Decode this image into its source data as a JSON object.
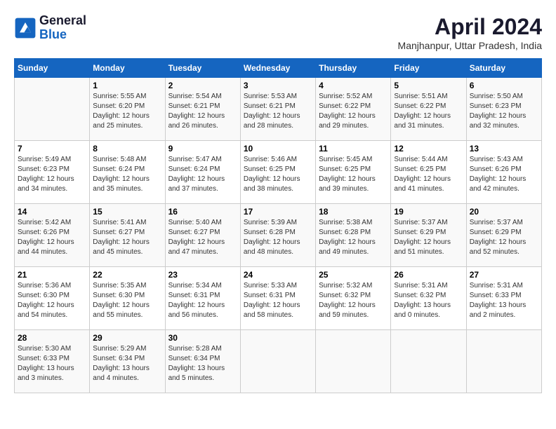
{
  "logo": {
    "line1": "General",
    "line2": "Blue"
  },
  "title": "April 2024",
  "location": "Manjhanpur, Uttar Pradesh, India",
  "weekdays": [
    "Sunday",
    "Monday",
    "Tuesday",
    "Wednesday",
    "Thursday",
    "Friday",
    "Saturday"
  ],
  "days": [
    {
      "num": "",
      "sunrise": "",
      "sunset": "",
      "daylight": ""
    },
    {
      "num": "1",
      "sunrise": "Sunrise: 5:55 AM",
      "sunset": "Sunset: 6:20 PM",
      "daylight": "Daylight: 12 hours and 25 minutes."
    },
    {
      "num": "2",
      "sunrise": "Sunrise: 5:54 AM",
      "sunset": "Sunset: 6:21 PM",
      "daylight": "Daylight: 12 hours and 26 minutes."
    },
    {
      "num": "3",
      "sunrise": "Sunrise: 5:53 AM",
      "sunset": "Sunset: 6:21 PM",
      "daylight": "Daylight: 12 hours and 28 minutes."
    },
    {
      "num": "4",
      "sunrise": "Sunrise: 5:52 AM",
      "sunset": "Sunset: 6:22 PM",
      "daylight": "Daylight: 12 hours and 29 minutes."
    },
    {
      "num": "5",
      "sunrise": "Sunrise: 5:51 AM",
      "sunset": "Sunset: 6:22 PM",
      "daylight": "Daylight: 12 hours and 31 minutes."
    },
    {
      "num": "6",
      "sunrise": "Sunrise: 5:50 AM",
      "sunset": "Sunset: 6:23 PM",
      "daylight": "Daylight: 12 hours and 32 minutes."
    },
    {
      "num": "7",
      "sunrise": "Sunrise: 5:49 AM",
      "sunset": "Sunset: 6:23 PM",
      "daylight": "Daylight: 12 hours and 34 minutes."
    },
    {
      "num": "8",
      "sunrise": "Sunrise: 5:48 AM",
      "sunset": "Sunset: 6:24 PM",
      "daylight": "Daylight: 12 hours and 35 minutes."
    },
    {
      "num": "9",
      "sunrise": "Sunrise: 5:47 AM",
      "sunset": "Sunset: 6:24 PM",
      "daylight": "Daylight: 12 hours and 37 minutes."
    },
    {
      "num": "10",
      "sunrise": "Sunrise: 5:46 AM",
      "sunset": "Sunset: 6:25 PM",
      "daylight": "Daylight: 12 hours and 38 minutes."
    },
    {
      "num": "11",
      "sunrise": "Sunrise: 5:45 AM",
      "sunset": "Sunset: 6:25 PM",
      "daylight": "Daylight: 12 hours and 39 minutes."
    },
    {
      "num": "12",
      "sunrise": "Sunrise: 5:44 AM",
      "sunset": "Sunset: 6:25 PM",
      "daylight": "Daylight: 12 hours and 41 minutes."
    },
    {
      "num": "13",
      "sunrise": "Sunrise: 5:43 AM",
      "sunset": "Sunset: 6:26 PM",
      "daylight": "Daylight: 12 hours and 42 minutes."
    },
    {
      "num": "14",
      "sunrise": "Sunrise: 5:42 AM",
      "sunset": "Sunset: 6:26 PM",
      "daylight": "Daylight: 12 hours and 44 minutes."
    },
    {
      "num": "15",
      "sunrise": "Sunrise: 5:41 AM",
      "sunset": "Sunset: 6:27 PM",
      "daylight": "Daylight: 12 hours and 45 minutes."
    },
    {
      "num": "16",
      "sunrise": "Sunrise: 5:40 AM",
      "sunset": "Sunset: 6:27 PM",
      "daylight": "Daylight: 12 hours and 47 minutes."
    },
    {
      "num": "17",
      "sunrise": "Sunrise: 5:39 AM",
      "sunset": "Sunset: 6:28 PM",
      "daylight": "Daylight: 12 hours and 48 minutes."
    },
    {
      "num": "18",
      "sunrise": "Sunrise: 5:38 AM",
      "sunset": "Sunset: 6:28 PM",
      "daylight": "Daylight: 12 hours and 49 minutes."
    },
    {
      "num": "19",
      "sunrise": "Sunrise: 5:37 AM",
      "sunset": "Sunset: 6:29 PM",
      "daylight": "Daylight: 12 hours and 51 minutes."
    },
    {
      "num": "20",
      "sunrise": "Sunrise: 5:37 AM",
      "sunset": "Sunset: 6:29 PM",
      "daylight": "Daylight: 12 hours and 52 minutes."
    },
    {
      "num": "21",
      "sunrise": "Sunrise: 5:36 AM",
      "sunset": "Sunset: 6:30 PM",
      "daylight": "Daylight: 12 hours and 54 minutes."
    },
    {
      "num": "22",
      "sunrise": "Sunrise: 5:35 AM",
      "sunset": "Sunset: 6:30 PM",
      "daylight": "Daylight: 12 hours and 55 minutes."
    },
    {
      "num": "23",
      "sunrise": "Sunrise: 5:34 AM",
      "sunset": "Sunset: 6:31 PM",
      "daylight": "Daylight: 12 hours and 56 minutes."
    },
    {
      "num": "24",
      "sunrise": "Sunrise: 5:33 AM",
      "sunset": "Sunset: 6:31 PM",
      "daylight": "Daylight: 12 hours and 58 minutes."
    },
    {
      "num": "25",
      "sunrise": "Sunrise: 5:32 AM",
      "sunset": "Sunset: 6:32 PM",
      "daylight": "Daylight: 12 hours and 59 minutes."
    },
    {
      "num": "26",
      "sunrise": "Sunrise: 5:31 AM",
      "sunset": "Sunset: 6:32 PM",
      "daylight": "Daylight: 13 hours and 0 minutes."
    },
    {
      "num": "27",
      "sunrise": "Sunrise: 5:31 AM",
      "sunset": "Sunset: 6:33 PM",
      "daylight": "Daylight: 13 hours and 2 minutes."
    },
    {
      "num": "28",
      "sunrise": "Sunrise: 5:30 AM",
      "sunset": "Sunset: 6:33 PM",
      "daylight": "Daylight: 13 hours and 3 minutes."
    },
    {
      "num": "29",
      "sunrise": "Sunrise: 5:29 AM",
      "sunset": "Sunset: 6:34 PM",
      "daylight": "Daylight: 13 hours and 4 minutes."
    },
    {
      "num": "30",
      "sunrise": "Sunrise: 5:28 AM",
      "sunset": "Sunset: 6:34 PM",
      "daylight": "Daylight: 13 hours and 5 minutes."
    },
    {
      "num": "",
      "sunrise": "",
      "sunset": "",
      "daylight": ""
    },
    {
      "num": "",
      "sunrise": "",
      "sunset": "",
      "daylight": ""
    },
    {
      "num": "",
      "sunrise": "",
      "sunset": "",
      "daylight": ""
    },
    {
      "num": "",
      "sunrise": "",
      "sunset": "",
      "daylight": ""
    }
  ]
}
